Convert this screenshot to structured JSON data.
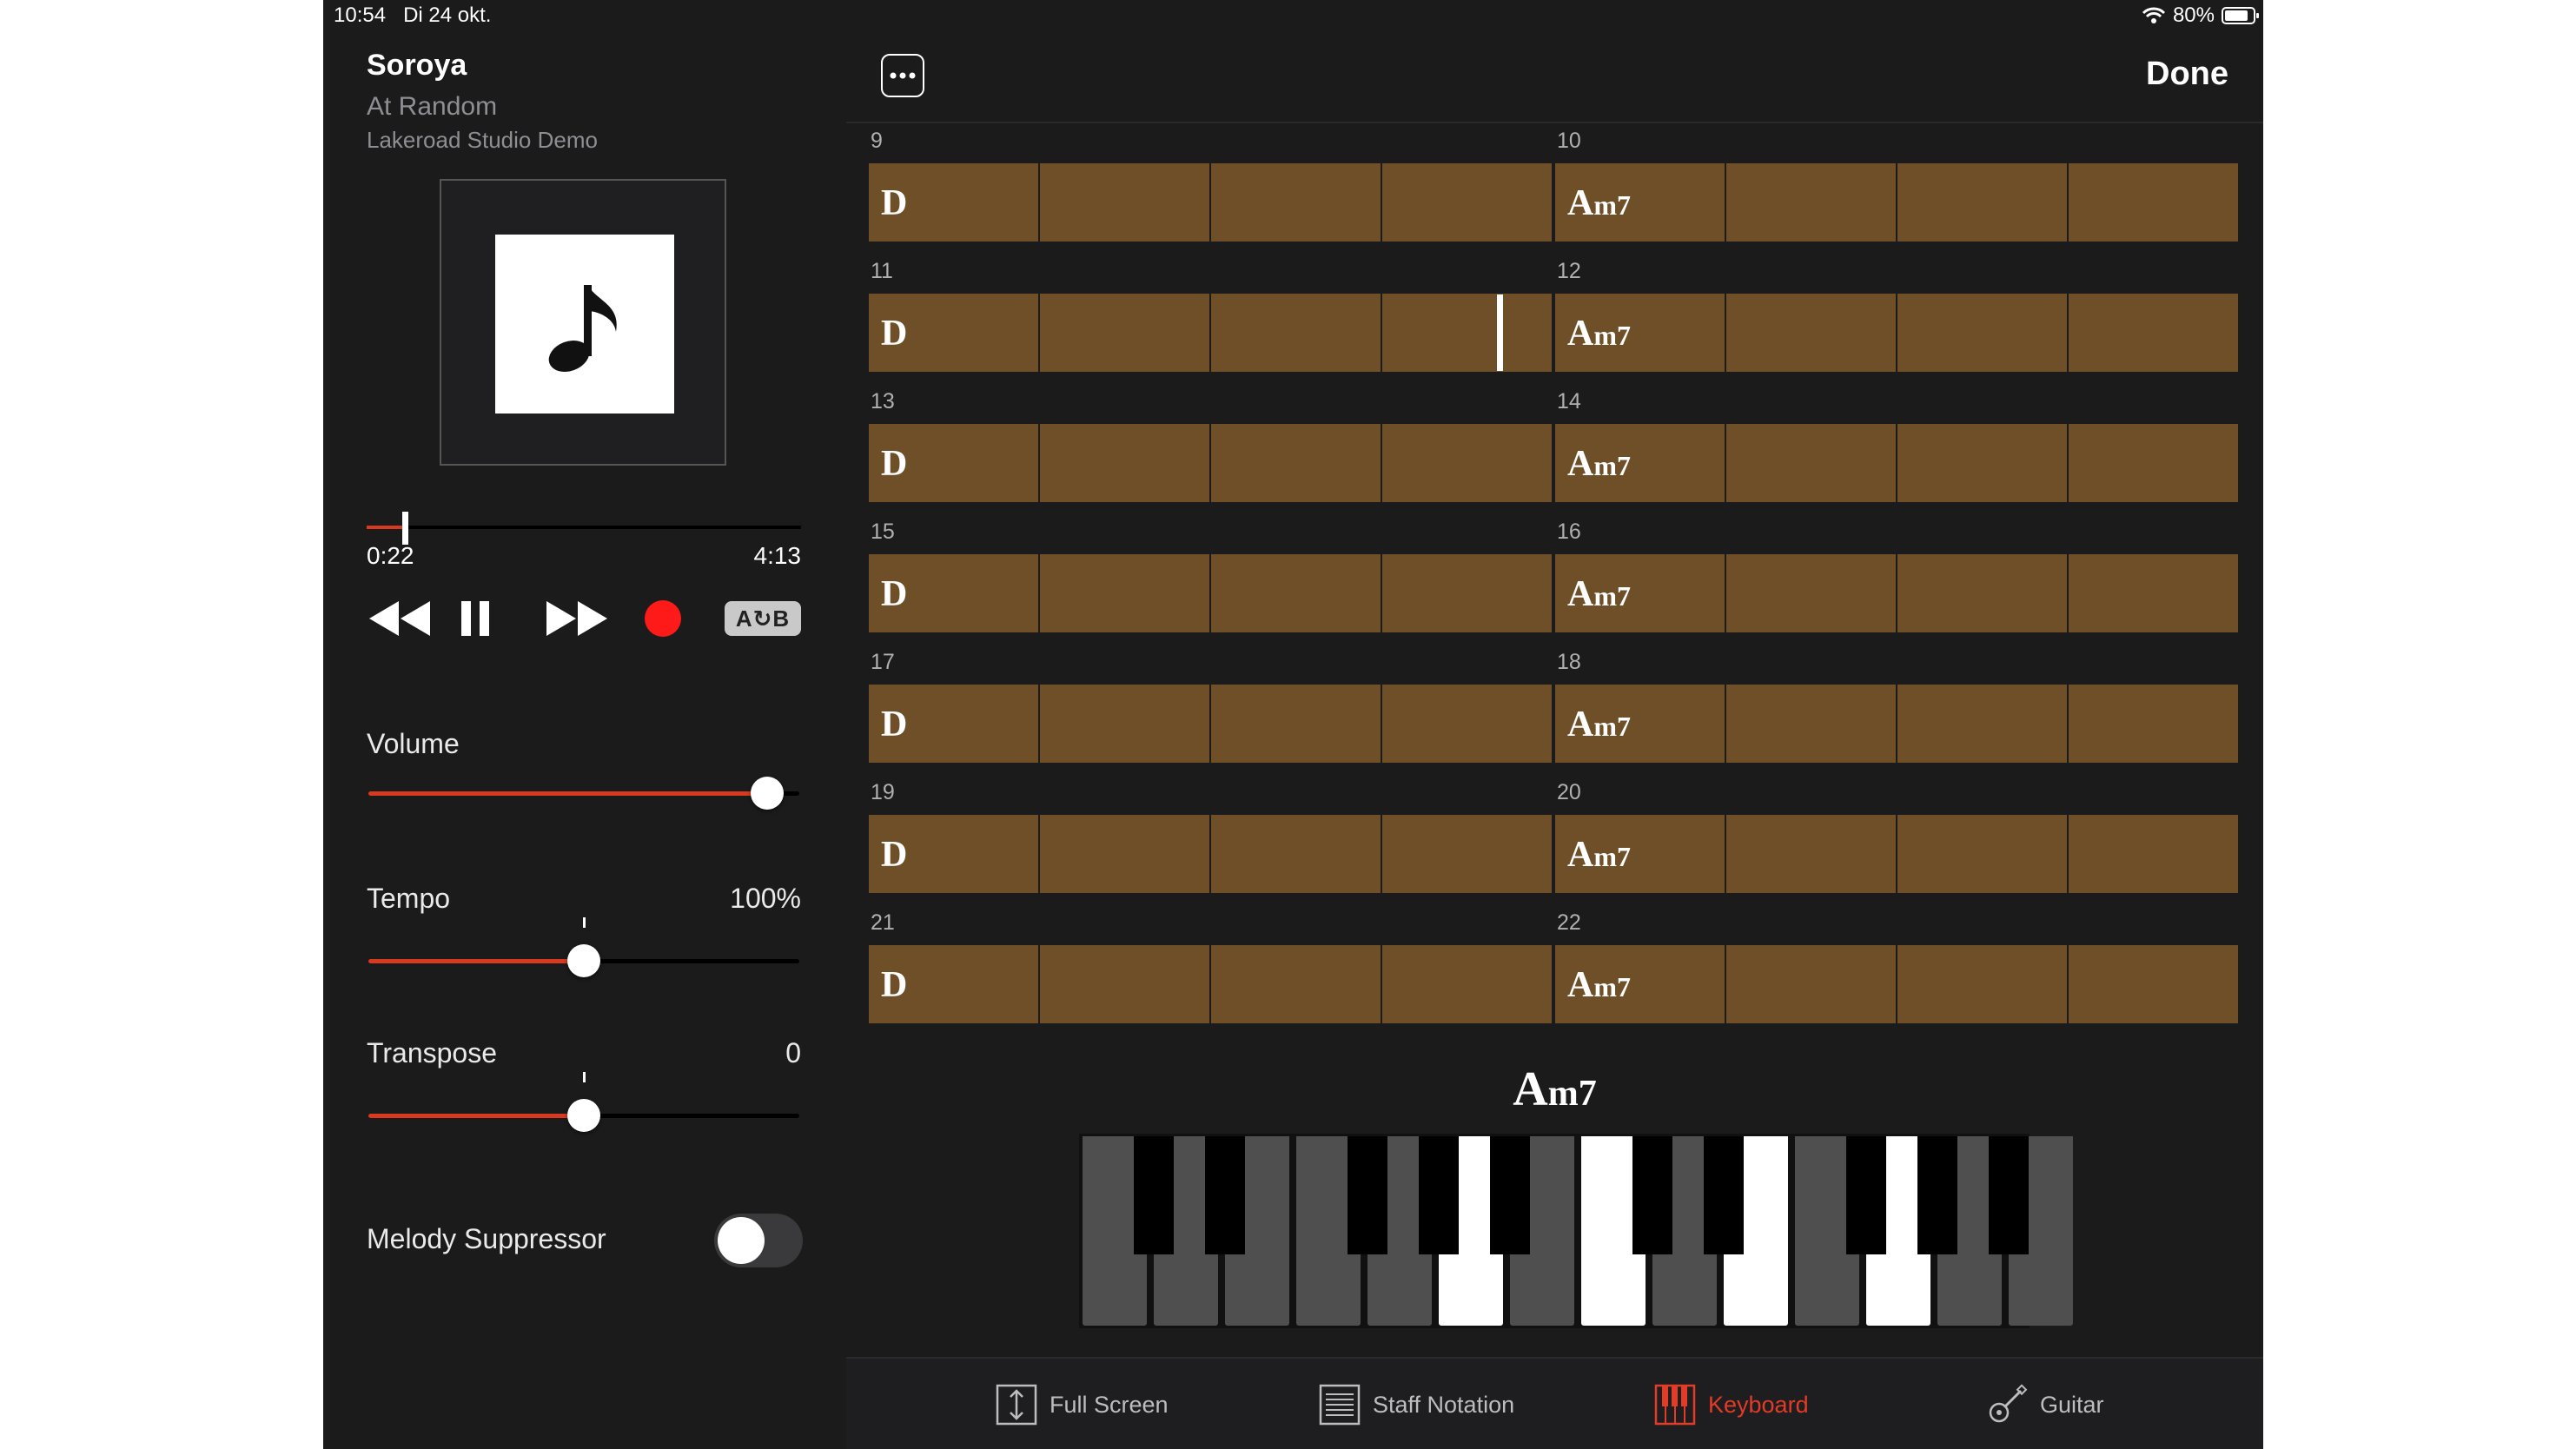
{
  "status": {
    "time": "10:54",
    "date": "Di 24 okt.",
    "battery": "80%"
  },
  "song": {
    "title": "Soroya",
    "artist": "At Random",
    "album": "Lakeroad Studio Demo"
  },
  "playback": {
    "elapsed": "0:22",
    "total": "4:13",
    "progress_fraction": 0.087
  },
  "controls": {
    "ab_label": "A↻B",
    "record_color": "#ff1a1a"
  },
  "sliders": {
    "volume": {
      "label": "Volume",
      "fraction": 0.925
    },
    "tempo": {
      "label": "Tempo",
      "value": "100%",
      "fraction": 0.5
    },
    "transpose": {
      "label": "Transpose",
      "value": "0",
      "fraction": 0.5
    }
  },
  "melody_suppressor": {
    "label": "Melody Suppressor",
    "on": false
  },
  "header": {
    "more_icon": "ellipsis-icon",
    "done_label": "Done"
  },
  "bars": [
    {
      "left": {
        "num": "9",
        "chord": "D"
      },
      "right": {
        "num": "10",
        "chord_root": "A",
        "chord_suffix": "m7"
      }
    },
    {
      "left": {
        "num": "11",
        "chord": "D"
      },
      "right": {
        "num": "12",
        "chord_root": "A",
        "chord_suffix": "m7"
      }
    },
    {
      "left": {
        "num": "13",
        "chord": "D"
      },
      "right": {
        "num": "14",
        "chord_root": "A",
        "chord_suffix": "m7"
      }
    },
    {
      "left": {
        "num": "15",
        "chord": "D"
      },
      "right": {
        "num": "16",
        "chord_root": "A",
        "chord_suffix": "m7"
      }
    },
    {
      "left": {
        "num": "17",
        "chord": "D"
      },
      "right": {
        "num": "18",
        "chord_root": "A",
        "chord_suffix": "m7"
      }
    },
    {
      "left": {
        "num": "19",
        "chord": "D"
      },
      "right": {
        "num": "20",
        "chord_root": "A",
        "chord_suffix": "m7"
      }
    },
    {
      "left": {
        "num": "21",
        "chord": "D"
      },
      "right": {
        "num": "22",
        "chord_root": "A",
        "chord_suffix": "m7"
      }
    }
  ],
  "current_chord": {
    "root": "A",
    "suffix": "m7"
  },
  "keyboard": {
    "highlighted_notes": [
      "A",
      "C",
      "E",
      "G"
    ]
  },
  "tabs": [
    {
      "label": "Full Screen",
      "icon": "fullscreen-icon",
      "active": false
    },
    {
      "label": "Staff Notation",
      "icon": "staff-notation-icon",
      "active": false
    },
    {
      "label": "Keyboard",
      "icon": "keyboard-icon",
      "active": true
    },
    {
      "label": "Guitar",
      "icon": "guitar-icon",
      "active": false
    }
  ],
  "colors": {
    "accent": "#d8391f",
    "bar_fill": "#6e4f27",
    "background": "#1b1b1c"
  }
}
